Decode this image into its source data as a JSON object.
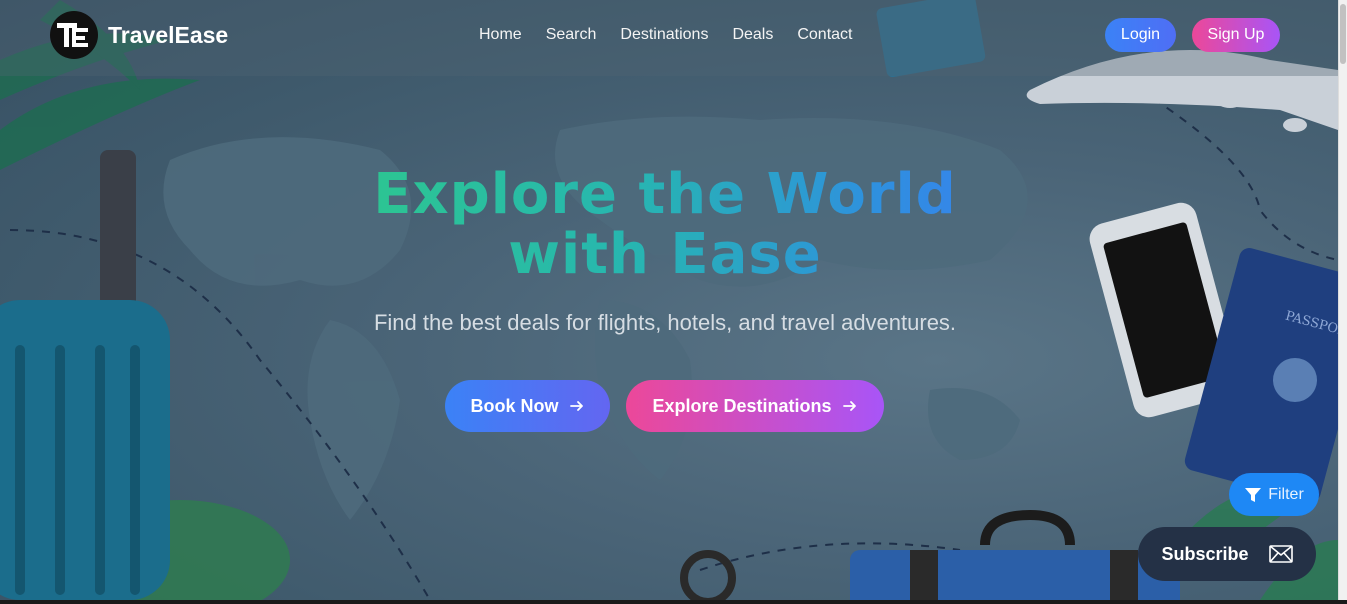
{
  "brand": {
    "logo_text": "TE",
    "name": "TravelEase"
  },
  "nav": {
    "items": [
      {
        "label": "Home"
      },
      {
        "label": "Search"
      },
      {
        "label": "Destinations"
      },
      {
        "label": "Deals"
      },
      {
        "label": "Contact"
      }
    ]
  },
  "auth": {
    "login_label": "Login",
    "signup_label": "Sign Up"
  },
  "hero": {
    "headline_line1": "Explore the World",
    "headline_line2": "with Ease",
    "subtitle": "Find the best deals for flights, hotels, and travel adventures.",
    "book_label": "Book Now",
    "explore_label": "Explore Destinations"
  },
  "floating": {
    "filter_label": "Filter",
    "subscribe_label": "Subscribe"
  },
  "background": {
    "passport_text": "PASSPORT"
  },
  "icons": {
    "arrow": "arrow-right-icon",
    "filter": "filter-icon",
    "mail": "mail-icon"
  },
  "colors": {
    "accent_blue": "#3b82f6",
    "accent_pink": "#ec4899",
    "accent_purple": "#a855f7",
    "headline_green": "#2ec98a",
    "headline_blue": "#2f8fe0"
  }
}
